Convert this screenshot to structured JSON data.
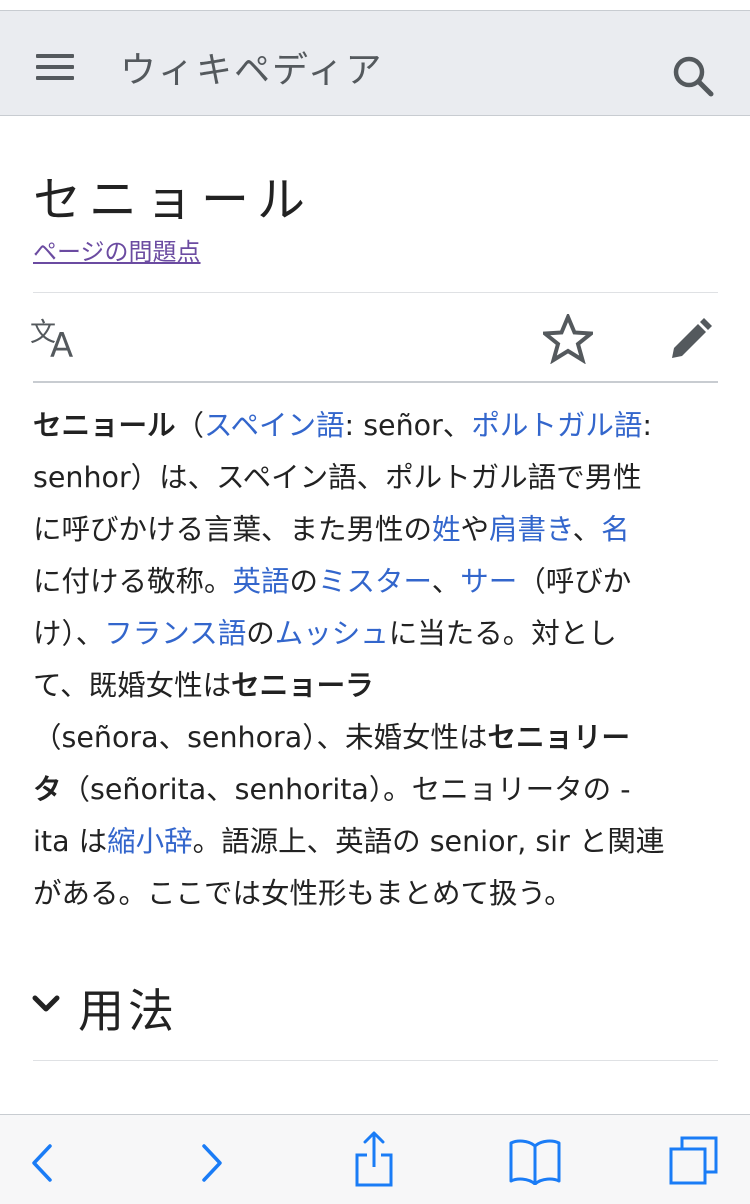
{
  "header": {
    "site_title": "ウィキペディア",
    "menu_icon": "hamburger-menu-icon",
    "search_icon": "search-icon"
  },
  "page": {
    "title": "セニョール",
    "issues_link": "ページの問題点"
  },
  "page_actions": {
    "language_icon": "translate-icon",
    "watch_icon": "star-icon",
    "edit_icon": "pencil-icon"
  },
  "article": {
    "l1": {
      "b": "セニョール",
      "t1": "（",
      "a1": "スペイン語",
      "t2": ": señor、",
      "a2": "ポルトガル語",
      "t3": ":"
    },
    "l2": {
      "t1": "senhor）は、スペイン語、ポルトガル語で男性"
    },
    "l3": {
      "t1": "に呼びかける言葉、また男性の",
      "a1": "姓",
      "t2": "や",
      "a2": "肩書き",
      "t3": "、",
      "a3": "名"
    },
    "l4": {
      "t1": "に付ける敬称。",
      "a1": "英語",
      "t2": "の",
      "a2": "ミスター",
      "t3": "、",
      "a3": "サー",
      "t4": "（呼びか"
    },
    "l5": {
      "t1": "け）、",
      "a1": "フランス語",
      "t2": "の",
      "a2": "ムッシュ",
      "t3": "に当たる。対とし"
    },
    "l6": {
      "t1": "て、既婚女性は",
      "b1": "セニョーラ"
    },
    "l7": {
      "t1": "（señora、senhora）、未婚女性は",
      "b1": "セニョリー"
    },
    "l8": {
      "b1": "タ",
      "t1": "（señorita、senhorita）。セニョリータの -"
    },
    "l9": {
      "t1": "ita は",
      "a1": "縮小辞",
      "t2": "。語源上、英語の senior, sir と関連"
    },
    "l10": {
      "t1": "がある。ここでは女性形もまとめて扱う。"
    }
  },
  "section": {
    "title": "用法",
    "toggle_icon": "chevron-down-icon"
  },
  "toolbar": {
    "back_icon": "back-arrow-icon",
    "forward_icon": "forward-arrow-icon",
    "share_icon": "share-icon",
    "bookmarks_icon": "bookmarks-icon",
    "tabs_icon": "tabs-icon",
    "accent_color": "#1a7cf6"
  },
  "colors": {
    "link": "#3366cc",
    "visited_link": "#6b4ba1",
    "header_bg": "#eaecf0",
    "icon_gray": "#54595d"
  }
}
